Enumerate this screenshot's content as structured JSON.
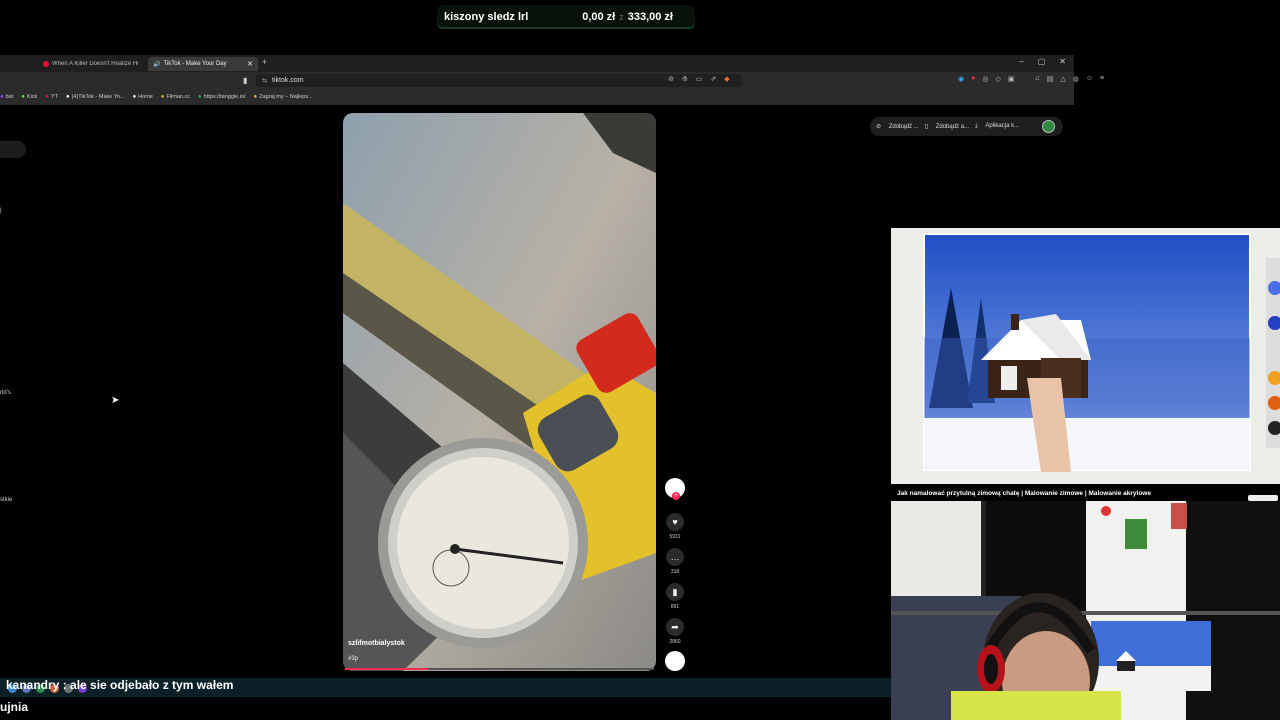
{
  "donation": {
    "name": "kiszony sledz lrl",
    "current": "0,00 zł",
    "separator": "z",
    "goal": "333,00 zł"
  },
  "browser": {
    "tabs": [
      {
        "label": "When A Killer Doesn't Realize He's B",
        "color": "#ff0033"
      },
      {
        "label": "TikTok - Make Your Day",
        "color": "#ffffff"
      }
    ],
    "url": "tiktok.com",
    "bookmarks": [
      {
        "label": "bat",
        "color": "#9146ff"
      },
      {
        "label": "Kick",
        "color": "#53fc18"
      },
      {
        "label": "YT",
        "color": "#ff0033"
      },
      {
        "label": "(4)TikTok - Make Yo...",
        "color": "#ffffff"
      },
      {
        "label": "Home",
        "color": "#ffffff"
      },
      {
        "label": "Filman.cc",
        "color": "#e8b93a"
      },
      {
        "label": "https://tanggle.io/",
        "color": "#39b54a"
      },
      {
        "label": "Zagraj.my – Najleps...",
        "color": "#f2c12e"
      }
    ]
  },
  "tiktok": {
    "left_fragments": [
      "rld's",
      "stkie"
    ],
    "video": {
      "username": "szlifmotbialystok",
      "hashtag": "#3p",
      "progress_percent": 27
    },
    "actions": {
      "likes": "5931",
      "comments": "318",
      "saves": "891",
      "shares": "2860"
    },
    "top_buttons": [
      "Zdobądź ...",
      "Zdobądź a...",
      "Aplikacja k..."
    ]
  },
  "chat": {
    "line1": "kanandry : ale sie odjebało z tym wałem",
    "line2": "ujnia"
  },
  "stream": {
    "video_title": "Jak namalować przytulną zimową chatę | Malowanie zimowe | Malowanie akrylowe"
  }
}
